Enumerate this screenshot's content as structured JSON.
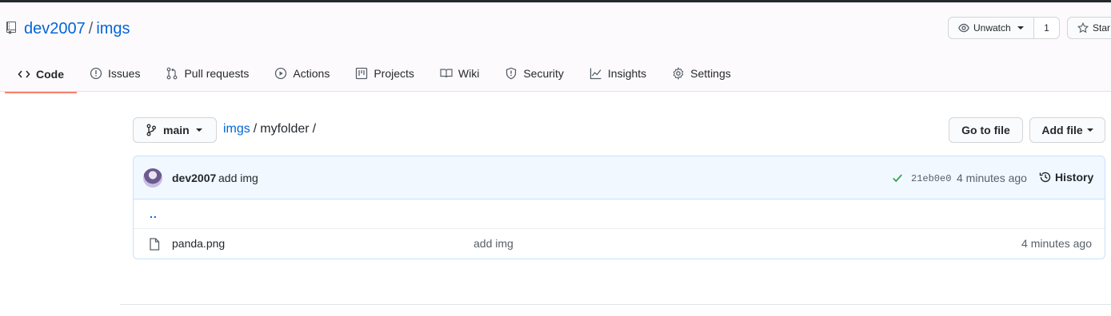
{
  "repo": {
    "owner": "dev2007",
    "separator": "/",
    "name": "imgs"
  },
  "header_actions": {
    "watch_label": "Unwatch",
    "watch_count": "1",
    "star_label": "Star"
  },
  "tabs": [
    {
      "label": "Code",
      "icon": "code-icon",
      "selected": true
    },
    {
      "label": "Issues",
      "icon": "issue-icon"
    },
    {
      "label": "Pull requests",
      "icon": "pull-request-icon"
    },
    {
      "label": "Actions",
      "icon": "play-icon"
    },
    {
      "label": "Projects",
      "icon": "project-icon"
    },
    {
      "label": "Wiki",
      "icon": "book-icon"
    },
    {
      "label": "Security",
      "icon": "shield-icon"
    },
    {
      "label": "Insights",
      "icon": "graph-icon"
    },
    {
      "label": "Settings",
      "icon": "gear-icon"
    }
  ],
  "navigation": {
    "branch": "main",
    "breadcrumb_root": "imgs",
    "breadcrumb_sep": "/",
    "breadcrumb_folder": "myfolder",
    "breadcrumb_trailing": "/",
    "goto_file": "Go to file",
    "add_file": "Add file"
  },
  "latest_commit": {
    "author": "dev2007",
    "message": "add img",
    "sha": "21eb0e0",
    "time": "4 minutes ago",
    "history_label": "History",
    "status_color": "#28a745"
  },
  "files": {
    "updir": "..",
    "rows": [
      {
        "name": "panda.png",
        "type": "file",
        "message": "add img",
        "time": "4 minutes ago"
      }
    ]
  },
  "colors": {
    "link": "#0366d6",
    "tab_underline": "#f9826c",
    "commit_bar_bg": "#f1f8ff"
  }
}
